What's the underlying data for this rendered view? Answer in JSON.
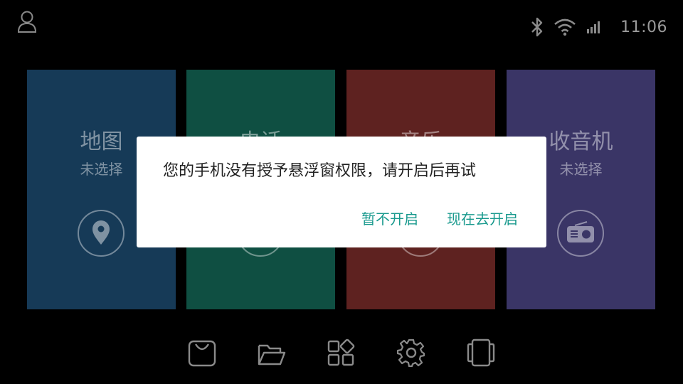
{
  "status_bar": {
    "time": "11:06",
    "icons": [
      "user-icon",
      "bluetooth-icon",
      "wifi-icon",
      "signal-icon"
    ]
  },
  "cards": [
    {
      "title": "地图",
      "subtitle": "未选择",
      "icon": "location-pin-icon",
      "color": "#163a57"
    },
    {
      "title": "电话",
      "subtitle": "",
      "icon": "phone-icon",
      "color": "#0f4f42"
    },
    {
      "title": "音乐",
      "subtitle": "",
      "icon": "music-icon",
      "color": "#5e2220"
    },
    {
      "title": "收音机",
      "subtitle": "未选择",
      "icon": "radio-icon",
      "color": "#3a3566"
    }
  ],
  "dialog": {
    "message": "您的手机没有授予悬浮窗权限，请开启后再试",
    "cancel_label": "暂不开启",
    "confirm_label": "现在去开启",
    "accent_color": "#1a9a8e"
  },
  "dock": {
    "icons": [
      "shopping-bag-icon",
      "folder-icon",
      "apps-grid-icon",
      "settings-gear-icon",
      "multi-window-icon"
    ]
  }
}
